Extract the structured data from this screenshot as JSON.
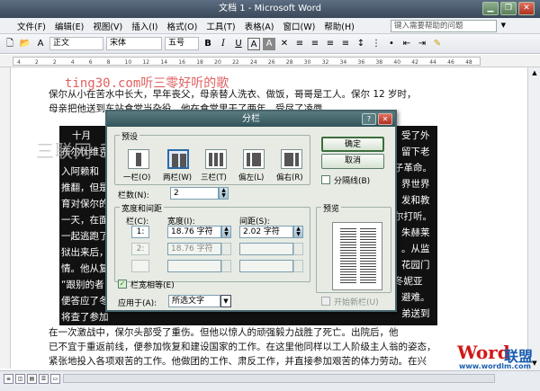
{
  "window": {
    "title": "文档 1 - Microsoft Word"
  },
  "menu": [
    "文件(F)",
    "编辑(E)",
    "视图(V)",
    "插入(I)",
    "格式(O)",
    "工具(T)",
    "表格(A)",
    "窗口(W)",
    "帮助(H)"
  ],
  "help_box": {
    "placeholder": "键入需要帮助的问题"
  },
  "toolbar": {
    "style": "正文",
    "font": "宋体",
    "size": "五号",
    "bold": "B",
    "italic": "I",
    "underline": "U",
    "fontcolor": "A",
    "charscale": "A"
  },
  "ruler_ticks": [
    "4",
    "2",
    "2",
    "4",
    "6",
    "8",
    "10",
    "12",
    "14",
    "16",
    "18",
    "20",
    "22",
    "24",
    "26",
    "28",
    "30",
    "32",
    "34",
    "36",
    "38",
    "40",
    "42",
    "44",
    "46",
    "48"
  ],
  "document": {
    "line1": "保尔从小在苦水中长大，早年丧父，母亲替人洗衣、做饭，哥哥是工人。保尔 12 岁时，",
    "line2": "母亲把他送到车站食堂当杂役，他在食堂里干了两年，受尽了凌辱。",
    "sel_lines": [
      "十月",
      "受了外",
      "留下老",
      "子革命。",
      "界世界",
      "发和教",
      "尔打听。",
      "朱赫莱",
      "。从监",
      "花园门",
      "冬妮亚",
      "避难。",
      "弟送到"
    ],
    "sel_left": [
      "布尔什维克",
      "入阿赖和",
      "推翻，但是",
      "育对保尔的",
      "一天，在面",
      "一起逃跑了",
      "狱出来后，",
      "情。他从复",
      "“跟别的者",
      "便答应了冬",
      "将查了参加"
    ],
    "line3": "在一次激战中，保尔头部受了重伤。但他以惊人的顽强毅力战胜了死亡。出院后，他",
    "line4": "已不宜于重返前线，便参加恢复和建设国家的工作。在这里他同样以工人阶级主人翁的姿态，",
    "line5": "紧张地投入各项艰苦的工作。他做团的工作、肃反工作，并直接参加艰苦的体力劳动。在兴"
  },
  "watermarks": {
    "text1": "ting30.com听三零好听的歌",
    "text2": "三联网 3LIAN.COM"
  },
  "logo": {
    "brand": "Word",
    "cn": "联盟",
    "url": "www.wordlm.com"
  },
  "dialog": {
    "title": "分栏",
    "preset_label": "预设",
    "presets": [
      "一栏(O)",
      "两栏(W)",
      "三栏(T)",
      "偏左(L)",
      "偏右(R)"
    ],
    "ok": "确定",
    "cancel": "取消",
    "line_between": "分隔线(B)",
    "num_cols_label": "栏数(N):",
    "num_cols": "2",
    "width_spacing_label": "宽度和间距",
    "col_header": "栏(C):",
    "width_header": "宽度(I):",
    "spacing_header": "间距(S):",
    "rows": [
      {
        "num": "1:",
        "width": "18.76 字符",
        "spacing": "2.02 字符"
      },
      {
        "num": "2:",
        "width": "18.76 字符",
        "spacing": ""
      },
      {
        "num": "",
        "width": "",
        "spacing": ""
      }
    ],
    "equal_width": "栏宽相等(E)",
    "apply_to_label": "应用于(A):",
    "apply_to": "所选文字",
    "preview_label": "预览",
    "start_new_col": "开始新栏(U)"
  }
}
